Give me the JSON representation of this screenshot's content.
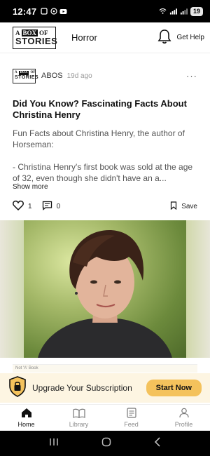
{
  "status_bar": {
    "time": "12:47",
    "battery": "19"
  },
  "header": {
    "logo": {
      "line1_a": "A",
      "line1_b": "BOX",
      "line1_c": "OF",
      "line2": "STORIES"
    },
    "category": "Horror",
    "get_help_label": "Get Help"
  },
  "post": {
    "author": "ABOS",
    "time_ago": "19d ago",
    "more_label": "···",
    "title": "Did You Know? Fascinating Facts About Christina Henry",
    "body_p1": "Fun Facts about Christina Henry, the author of Horseman:",
    "body_p2": "- Christina Henry's first book was sold at the age of 32, even though she didn't have an a...",
    "show_more_label": "Show more",
    "likes": "1",
    "comments": "0",
    "save_label": "Save"
  },
  "strip_text": "Not 'A' Book",
  "upgrade": {
    "text": "Upgrade Your Subscription",
    "button_label": "Start Now",
    "button_color": "#f4c25c",
    "background_color": "#fdf5e2"
  },
  "bottom_nav": {
    "items": [
      {
        "label": "Home",
        "icon": "home-icon",
        "active": true
      },
      {
        "label": "Library",
        "icon": "book-icon",
        "active": false
      },
      {
        "label": "Feed",
        "icon": "feed-icon",
        "active": false
      },
      {
        "label": "Profile",
        "icon": "profile-icon",
        "active": false
      }
    ]
  }
}
